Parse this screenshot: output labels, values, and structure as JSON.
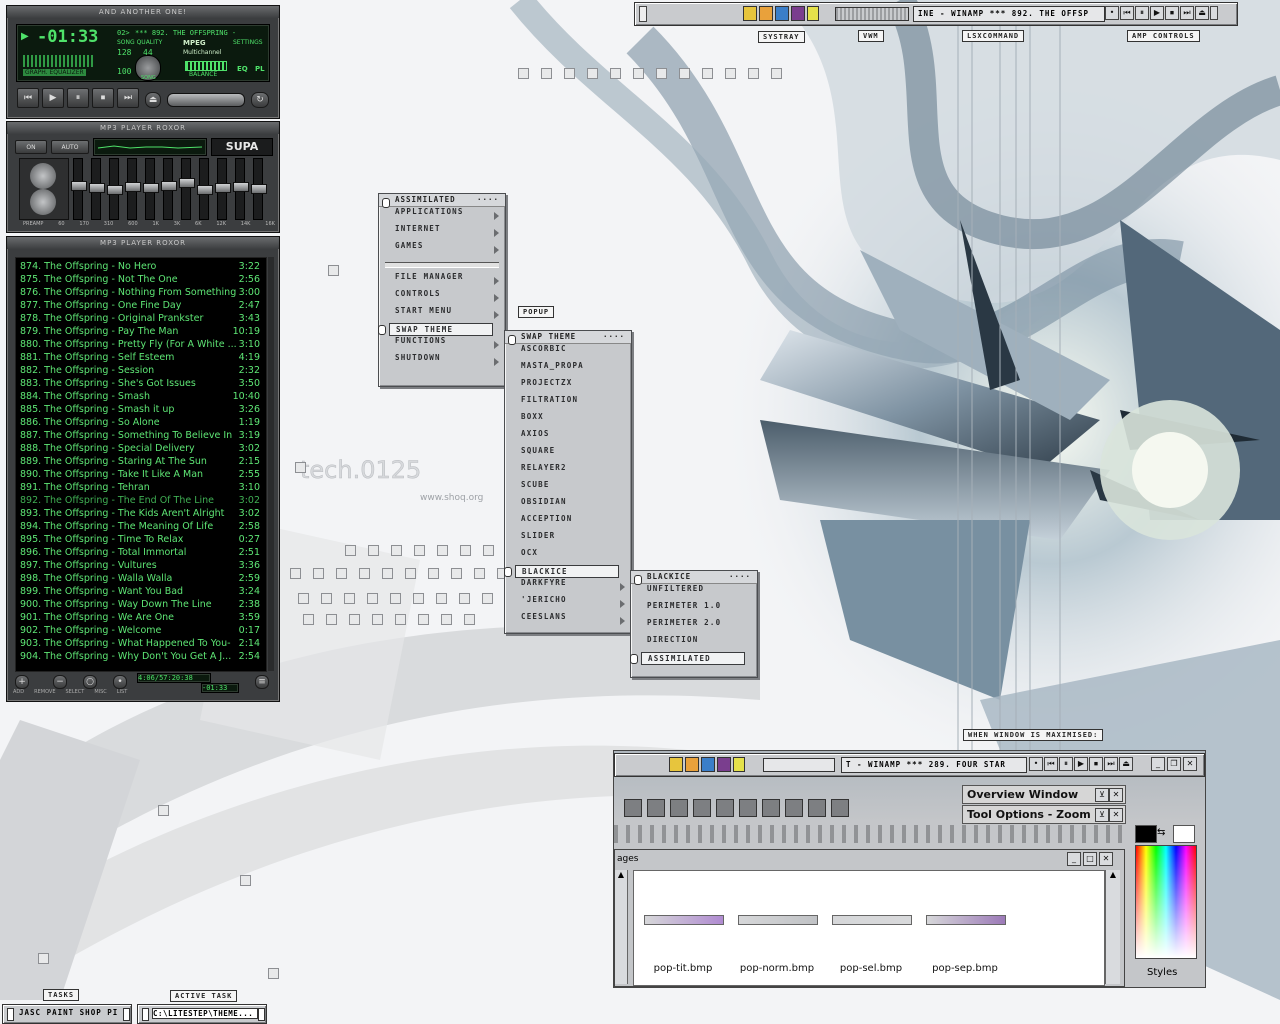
{
  "winamp": {
    "title": "AND ANOTHER ONE!",
    "time": "-01:33",
    "track_no": "02>",
    "ticker": "*** 892. THE OFFSPRING -",
    "kbps": "128",
    "khz": "44",
    "song_quality": "SONG QUALITY",
    "mpeg": "MPEG",
    "multichannel": "Multichannel",
    "settings": "SETTINGS",
    "graph_eq": "GRAPH. EQUALIZER",
    "volume_val": "100",
    "balance": "BALANCE",
    "eq_btn": "EQ",
    "pl_btn": "PL",
    "song_lbl": "SONG",
    "eq_title": "MP3 PLAYER ROXOR",
    "eq_on": "ON",
    "eq_auto": "AUTO",
    "eq_preset": "SUPA",
    "eq_bands": [
      "PREAMP",
      "60",
      "170",
      "310",
      "600",
      "1K",
      "3K",
      "6K",
      "12K",
      "14K",
      "16K"
    ],
    "pl_title": "MP3 PLAYER ROXOR",
    "pl_total": "4:06/57:20:38",
    "pl_time": "-01:33",
    "pl_btns": [
      "ADD",
      "REMOVE",
      "SELECT",
      "MISC",
      "LIST"
    ],
    "playlist": [
      {
        "t": "874. The Offspring - No Hero",
        "d": "3:22"
      },
      {
        "t": "875. The Offspring - Not The One",
        "d": "2:56"
      },
      {
        "t": "876. The Offspring - Nothing From Something",
        "d": "3:00"
      },
      {
        "t": "877. The Offspring - One Fine Day",
        "d": "2:47"
      },
      {
        "t": "878. The Offspring - Original Prankster",
        "d": "3:43"
      },
      {
        "t": "879. The Offspring - Pay The Man",
        "d": "10:19"
      },
      {
        "t": "880. The Offspring - Pretty Fly (For A White ...",
        "d": "3:10"
      },
      {
        "t": "881. The Offspring - Self Esteem",
        "d": "4:19"
      },
      {
        "t": "882. The Offspring - Session",
        "d": "2:32"
      },
      {
        "t": "883. The Offspring - She's Got Issues",
        "d": "3:50"
      },
      {
        "t": "884. The Offspring - Smash",
        "d": "10:40"
      },
      {
        "t": "885. The Offspring - Smash it up",
        "d": "3:26"
      },
      {
        "t": "886. The Offspring - So Alone",
        "d": "1:19"
      },
      {
        "t": "887. The Offspring - Something To Believe In",
        "d": "3:19"
      },
      {
        "t": "888. The Offspring - Special Delivery",
        "d": "3:02"
      },
      {
        "t": "889. The Offspring - Staring At The Sun",
        "d": "2:15"
      },
      {
        "t": "890. The Offspring - Take It Like A Man",
        "d": "2:55"
      },
      {
        "t": "891. The Offspring - Tehran",
        "d": "3:10"
      },
      {
        "t": "892. The Offspring - The End Of The Line",
        "d": "3:02",
        "dim": true
      },
      {
        "t": "893. The Offspring - The Kids Aren't Alright",
        "d": "3:02"
      },
      {
        "t": "894. The Offspring - The Meaning Of Life",
        "d": "2:58"
      },
      {
        "t": "895. The Offspring - Time To Relax",
        "d": "0:27"
      },
      {
        "t": "896. The Offspring - Total Immortal",
        "d": "2:51"
      },
      {
        "t": "897. The Offspring - Vultures",
        "d": "3:36"
      },
      {
        "t": "898. The Offspring - Walla Walla",
        "d": "2:59"
      },
      {
        "t": "899. The Offspring - Want You Bad",
        "d": "3:24"
      },
      {
        "t": "900. The Offspring - Way Down The Line",
        "d": "2:38"
      },
      {
        "t": "901. The Offspring - We Are One",
        "d": "3:59"
      },
      {
        "t": "902. The Offspring - Welcome",
        "d": "0:17"
      },
      {
        "t": "903. The Offspring - What Happened To You-",
        "d": "2:14"
      },
      {
        "t": "904. The Offspring - Why Don't You Get A J...",
        "d": "2:54"
      }
    ]
  },
  "topbar": {
    "ticker": "INE - WINAMP *** 892. THE OFFSP",
    "labels": {
      "systray": "SYSTRAY",
      "vwm": "VWM",
      "lsx": "LSXCOMMAND",
      "amp": "AMP CONTROLS"
    },
    "amp_btns": [
      "•",
      "⏮",
      "⏸",
      "▶",
      "⏹",
      "⏭",
      "⏏"
    ]
  },
  "menu_main": {
    "title": "ASSIMILATED",
    "items_a": [
      "APPLICATIONS",
      "INTERNET",
      "GAMES"
    ],
    "items_b": [
      "FILE MANAGER",
      "CONTROLS",
      "START MENU"
    ],
    "selected": "SWAP THEME",
    "items_c": [
      "FUNCTIONS",
      "SHUTDOWN"
    ]
  },
  "popup_label": "POPUP",
  "menu_theme": {
    "title": "SWAP THEME",
    "items_a": [
      "ASCORBIC",
      "MASTA_PROPA",
      "PROJECTZX",
      "FILTRATION",
      "BOXX",
      "AXIOS",
      "SQUARE",
      "RELAYER2",
      "SCUBE",
      "OBSIDIAN",
      "ACCEPTION",
      "SLIDER",
      "OCX"
    ],
    "selected": "BLACKICE",
    "items_b": [
      "DARKFYRE",
      "'JERICHO",
      "CEESLANS"
    ]
  },
  "menu_blackice": {
    "title": "BLACKICE",
    "items": [
      "UNFILTERED",
      "PERIMETER 1.0",
      "PERIMETER 2.0",
      "DIRECTION"
    ],
    "selected": "ASSIMILATED"
  },
  "maximised_label": "WHEN WINDOW IS MAXIMISED:",
  "psp": {
    "bar_ticker": "T - WINAMP *** 289. FOUR STAR",
    "overview": "Overview Window",
    "tool_options": "Tool Options - Zoom",
    "browser_title": "ages",
    "thumbs": [
      "pop-tit.bmp",
      "pop-norm.bmp",
      "pop-sel.bmp",
      "pop-sep.bmp"
    ],
    "styles": "Styles"
  },
  "taskbar": {
    "tasks_lbl": "TASKS",
    "active_lbl": "ACTIVE TASK",
    "task1": "JASC PAINT SHOP PI",
    "task2": "C:\\LITESTEP\\THEME..."
  },
  "wall_text": {
    "tech": "tech.0125",
    "url": "www.shoq.org"
  }
}
